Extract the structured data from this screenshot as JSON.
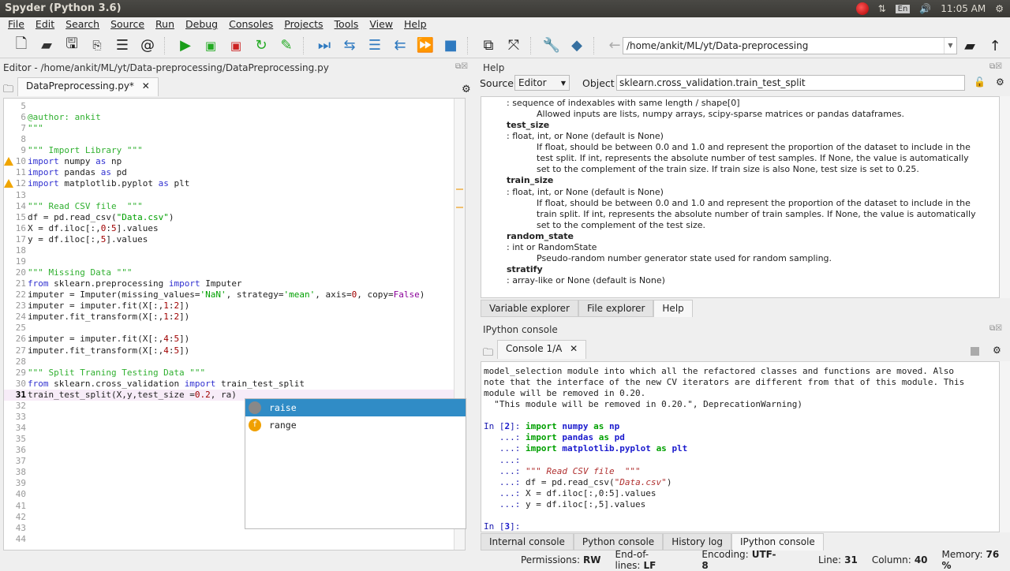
{
  "window": {
    "title": "Spyder (Python 3.6)",
    "clock": "11:05 AM",
    "lang": "En"
  },
  "menu": [
    "File",
    "Edit",
    "Search",
    "Source",
    "Run",
    "Debug",
    "Consoles",
    "Projects",
    "Tools",
    "View",
    "Help"
  ],
  "toolbar": {
    "path": "/home/ankit/ML/yt/Data-preprocessing"
  },
  "editor": {
    "title": "Editor - /home/ankit/ML/yt/Data-preprocessing/DataPreprocessing.py",
    "tab": "DataPreprocessing.py*",
    "current_line": 31,
    "lines": [
      {
        "n": "5",
        "s": []
      },
      {
        "n": "6",
        "s": [
          [
            "@author: ankit",
            "doc"
          ]
        ]
      },
      {
        "n": "7",
        "s": [
          [
            "\"\"\"",
            "doc"
          ]
        ]
      },
      {
        "n": "8",
        "s": []
      },
      {
        "n": "9",
        "s": [
          [
            "\"\"\" Import Library \"\"\"",
            "doc"
          ]
        ]
      },
      {
        "n": "10",
        "w": true,
        "s": [
          [
            "import",
            "kw"
          ],
          [
            " numpy ",
            "pl"
          ],
          [
            "as",
            "kw"
          ],
          [
            " np",
            "pl"
          ]
        ]
      },
      {
        "n": "11",
        "s": [
          [
            "import",
            "kw"
          ],
          [
            " pandas ",
            "pl"
          ],
          [
            "as",
            "kw"
          ],
          [
            " pd",
            "pl"
          ]
        ]
      },
      {
        "n": "12",
        "w": true,
        "s": [
          [
            "import",
            "kw"
          ],
          [
            " matplotlib.pyplot ",
            "pl"
          ],
          [
            "as",
            "kw"
          ],
          [
            " plt",
            "pl"
          ]
        ]
      },
      {
        "n": "13",
        "s": []
      },
      {
        "n": "14",
        "s": [
          [
            "\"\"\" Read CSV file  \"\"\"",
            "doc"
          ]
        ]
      },
      {
        "n": "15",
        "s": [
          [
            "df = pd.read_csv(",
            "pl"
          ],
          [
            "\"Data.csv\"",
            "str"
          ],
          [
            ")",
            "pl"
          ]
        ]
      },
      {
        "n": "16",
        "s": [
          [
            "X = df.iloc[:,",
            "pl"
          ],
          [
            "0",
            "num"
          ],
          [
            ":",
            "pl"
          ],
          [
            "5",
            "num"
          ],
          [
            "].values",
            "pl"
          ]
        ]
      },
      {
        "n": "17",
        "s": [
          [
            "y = df.iloc[:,",
            "pl"
          ],
          [
            "5",
            "num"
          ],
          [
            "].values",
            "pl"
          ]
        ]
      },
      {
        "n": "18",
        "s": []
      },
      {
        "n": "19",
        "s": []
      },
      {
        "n": "20",
        "s": [
          [
            "\"\"\" Missing Data \"\"\"",
            "doc"
          ]
        ]
      },
      {
        "n": "21",
        "s": [
          [
            "from",
            "kw"
          ],
          [
            " sklearn.preprocessing ",
            "pl"
          ],
          [
            "import",
            "kw"
          ],
          [
            " Imputer",
            "pl"
          ]
        ]
      },
      {
        "n": "22",
        "s": [
          [
            "imputer = Imputer(missing_values=",
            "pl"
          ],
          [
            "'NaN'",
            "str"
          ],
          [
            ", strategy=",
            "pl"
          ],
          [
            "'mean'",
            "str"
          ],
          [
            ", axis=",
            "pl"
          ],
          [
            "0",
            "num"
          ],
          [
            ", copy=",
            "pl"
          ],
          [
            "False",
            "bool"
          ],
          [
            ")",
            "pl"
          ]
        ]
      },
      {
        "n": "23",
        "s": [
          [
            "imputer = imputer.fit(X[:,",
            "pl"
          ],
          [
            "1",
            "num"
          ],
          [
            ":",
            "pl"
          ],
          [
            "2",
            "num"
          ],
          [
            "])",
            "pl"
          ]
        ]
      },
      {
        "n": "24",
        "s": [
          [
            "imputer.fit_transform(X[:,",
            "pl"
          ],
          [
            "1",
            "num"
          ],
          [
            ":",
            "pl"
          ],
          [
            "2",
            "num"
          ],
          [
            "])",
            "pl"
          ]
        ]
      },
      {
        "n": "25",
        "s": []
      },
      {
        "n": "26",
        "s": [
          [
            "imputer = imputer.fit(X[:,",
            "pl"
          ],
          [
            "4",
            "num"
          ],
          [
            ":",
            "pl"
          ],
          [
            "5",
            "num"
          ],
          [
            "])",
            "pl"
          ]
        ]
      },
      {
        "n": "27",
        "s": [
          [
            "imputer.fit_transform(X[:,",
            "pl"
          ],
          [
            "4",
            "num"
          ],
          [
            ":",
            "pl"
          ],
          [
            "5",
            "num"
          ],
          [
            "])",
            "pl"
          ]
        ]
      },
      {
        "n": "28",
        "s": []
      },
      {
        "n": "29",
        "s": [
          [
            "\"\"\" Split Traning Testing Data \"\"\"",
            "doc"
          ]
        ]
      },
      {
        "n": "30",
        "s": [
          [
            "from",
            "kw"
          ],
          [
            " sklearn.cross_validation ",
            "pl"
          ],
          [
            "import",
            "kw"
          ],
          [
            " train_test_split",
            "pl"
          ]
        ]
      },
      {
        "n": "31",
        "s": [
          [
            "train_test_split(X,y,test_size =",
            "pl"
          ],
          [
            "0.2",
            "num"
          ],
          [
            ", ra)",
            "pl"
          ]
        ]
      },
      {
        "n": "32",
        "s": []
      },
      {
        "n": "33",
        "s": []
      },
      {
        "n": "34",
        "s": []
      },
      {
        "n": "35",
        "s": []
      },
      {
        "n": "36",
        "s": []
      },
      {
        "n": "37",
        "s": []
      },
      {
        "n": "38",
        "s": []
      },
      {
        "n": "39",
        "s": []
      },
      {
        "n": "40",
        "s": []
      },
      {
        "n": "41",
        "s": []
      },
      {
        "n": "42",
        "s": []
      },
      {
        "n": "43",
        "s": []
      },
      {
        "n": "44",
        "s": []
      }
    ],
    "completions": [
      {
        "label": "raise",
        "icon": "",
        "color": "#888888"
      },
      {
        "label": "range",
        "icon": "f",
        "color": "#f0a000"
      }
    ]
  },
  "help": {
    "title": "Help",
    "source_label": "Source",
    "source_value": "Editor",
    "object_label": "Object",
    "object_value": "sklearn.cross_validation.train_test_split",
    "lines": [
      {
        "t": "p",
        "x": ": sequence of indexables with same length / shape[0]"
      },
      {
        "t": "d",
        "x": "Allowed inputs are lists, numpy arrays, scipy-sparse matrices or pandas dataframes."
      },
      {
        "t": "h",
        "x": "test_size"
      },
      {
        "t": "p",
        "x": ": float, int, or None (default is None)"
      },
      {
        "t": "d",
        "x": "If float, should be between 0.0 and 1.0 and represent the proportion of the dataset to include in the"
      },
      {
        "t": "d",
        "x": "test split. If int, represents the absolute number of test samples. If None, the value is automatically"
      },
      {
        "t": "d",
        "x": "set to the complement of the train size. If train size is also None, test size is set to 0.25."
      },
      {
        "t": "h",
        "x": "train_size"
      },
      {
        "t": "p",
        "x": ": float, int, or None (default is None)"
      },
      {
        "t": "d",
        "x": "If float, should be between 0.0 and 1.0 and represent the proportion of the dataset to include in the"
      },
      {
        "t": "d",
        "x": "train split. If int, represents the absolute number of train samples. If None, the value is automatically"
      },
      {
        "t": "d",
        "x": "set to the complement of the test size."
      },
      {
        "t": "h",
        "x": "random_state"
      },
      {
        "t": "p",
        "x": ": int or RandomState"
      },
      {
        "t": "d",
        "x": "Pseudo-random number generator state used for random sampling."
      },
      {
        "t": "h",
        "x": "stratify"
      },
      {
        "t": "p",
        "x": ": array-like or None (default is None)"
      }
    ],
    "tabs": [
      "Variable explorer",
      "File explorer",
      "Help"
    ]
  },
  "console": {
    "title": "IPython console",
    "tab": "Console 1/A",
    "lines": [
      [
        [
          "model_selection module into which all the refactored classes and functions are moved. Also",
          ""
        ]
      ],
      [
        [
          "note that the interface of the new CV iterators are different from that of this module. This",
          ""
        ]
      ],
      [
        [
          "module will be removed in 0.20.",
          ""
        ]
      ],
      [
        [
          "  \"This module will be removed in 0.20.\", DeprecationWarning)",
          ""
        ]
      ],
      [],
      [
        [
          "In [",
          "cp"
        ],
        [
          "2",
          "cb"
        ],
        [
          "]: ",
          "cp"
        ],
        [
          "import ",
          "cg"
        ],
        [
          "numpy ",
          "cb"
        ],
        [
          "as ",
          "cg"
        ],
        [
          "np",
          "cb"
        ]
      ],
      [
        [
          "   ...: ",
          "cp"
        ],
        [
          "import ",
          "cg"
        ],
        [
          "pandas ",
          "cb"
        ],
        [
          "as ",
          "cg"
        ],
        [
          "pd",
          "cb"
        ]
      ],
      [
        [
          "   ...: ",
          "cp"
        ],
        [
          "import ",
          "cg"
        ],
        [
          "matplotlib.pyplot ",
          "cb"
        ],
        [
          "as ",
          "cg"
        ],
        [
          "plt",
          "cb"
        ]
      ],
      [
        [
          "   ...: ",
          "cp"
        ]
      ],
      [
        [
          "   ...: ",
          "cp"
        ],
        [
          "\"\"\" Read CSV file  \"\"\"",
          "ci2"
        ]
      ],
      [
        [
          "   ...: ",
          "cp"
        ],
        [
          "df = pd.read_csv(",
          ""
        ],
        [
          "\"Data.csv\"",
          "ci2"
        ],
        [
          ")",
          ""
        ]
      ],
      [
        [
          "   ...: ",
          "cp"
        ],
        [
          "X = df.iloc[:,0:5].values",
          ""
        ]
      ],
      [
        [
          "   ...: ",
          "cp"
        ],
        [
          "y = df.iloc[:,5].values",
          ""
        ]
      ],
      [],
      [
        [
          "In [",
          "cp"
        ],
        [
          "3",
          "cb"
        ],
        [
          "]: ",
          "cp"
        ]
      ]
    ],
    "tabs": [
      "Internal console",
      "Python console",
      "History log",
      "IPython console"
    ]
  },
  "status": {
    "permissions_label": "Permissions:",
    "permissions": "RW",
    "eol_label": "End-of-lines:",
    "eol": "LF",
    "encoding_label": "Encoding:",
    "encoding": "UTF-8",
    "line_label": "Line:",
    "line": "31",
    "column_label": "Column:",
    "column": "40",
    "memory_label": "Memory:",
    "memory": "76 %"
  }
}
